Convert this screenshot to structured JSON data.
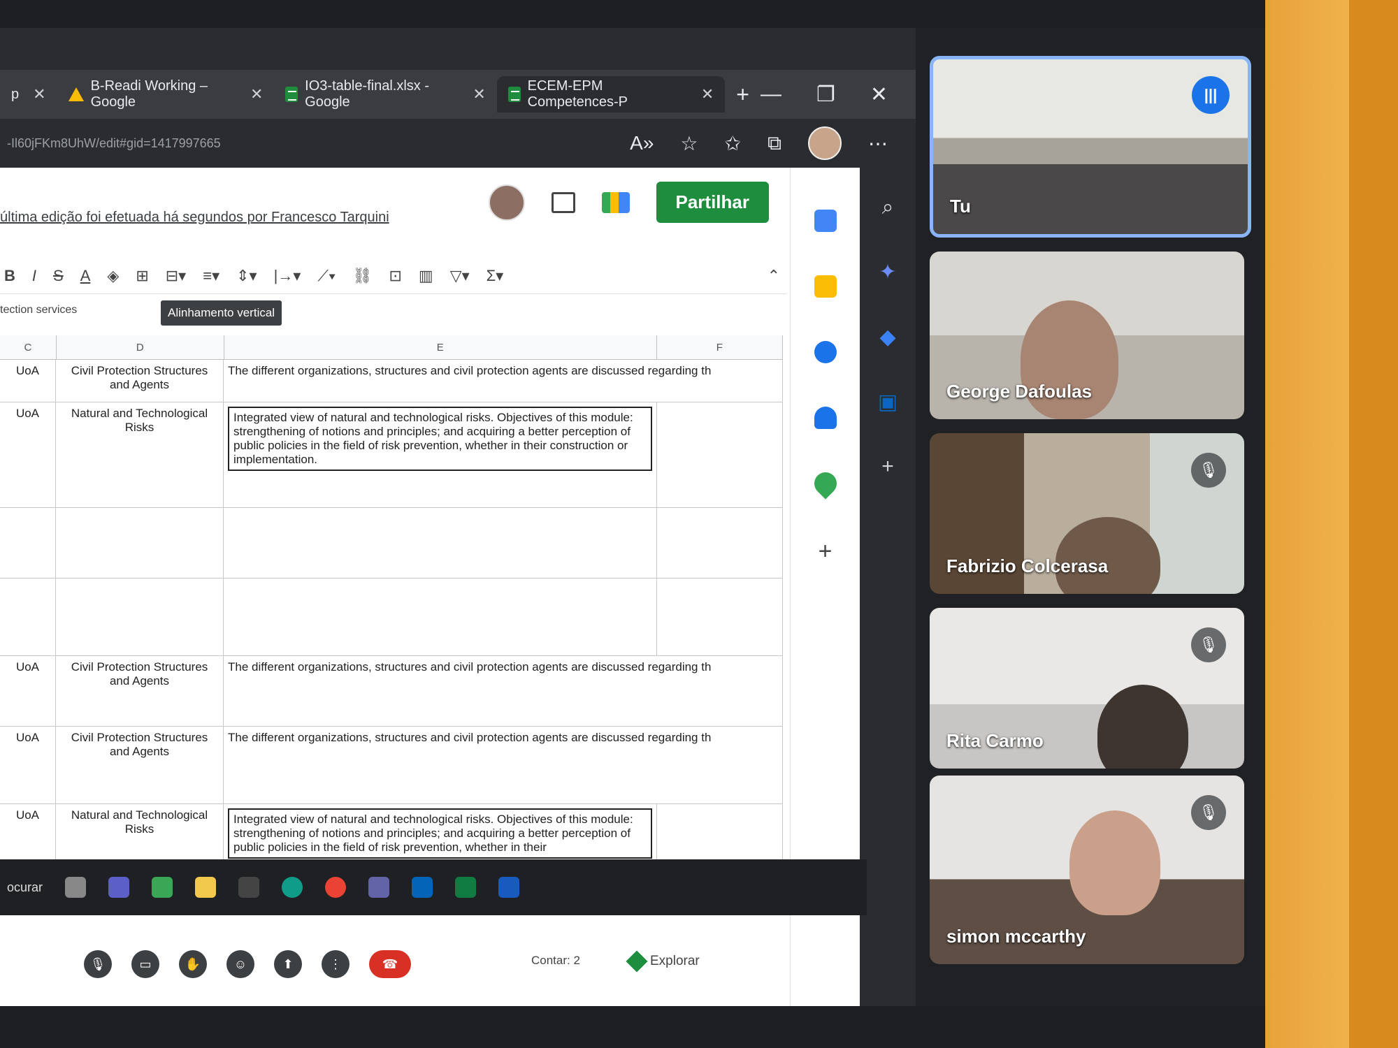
{
  "tabs": [
    {
      "label": "p"
    },
    {
      "label": "B-Readi Working – Google"
    },
    {
      "label": "IO3-table-final.xlsx - Google"
    },
    {
      "label": "ECEM-EPM Competences-P"
    }
  ],
  "url": "-Il60jFKm8UhW/edit#gid=1417997665",
  "sheet": {
    "edit_note": "última edição foi efetuada há segundos por Francesco Tarquini",
    "share_label": "Partilhar",
    "tooltip": "Alinhamento vertical",
    "namebox": "tection services",
    "columns": [
      "C",
      "D",
      "E",
      "F"
    ],
    "rows": [
      {
        "c": "UoA",
        "d": "Civil Protection Structures and Agents",
        "e": "The different organizations, structures and civil protection agents are discussed regarding th"
      },
      {
        "c": "UoA",
        "d": "Natural and Technological Risks",
        "e": "Integrated view of natural and technological risks. Objectives of this module: strengthening of notions and principles; and acquiring a better perception of public policies in the field of risk prevention, whether in their construction or implementation."
      },
      {
        "c": "",
        "d": "",
        "e": ""
      },
      {
        "c": "",
        "d": "",
        "e": ""
      },
      {
        "c": "UoA",
        "d": "Civil Protection Structures and Agents",
        "e": "The different organizations, structures and civil protection agents are discussed regarding th"
      },
      {
        "c": "UoA",
        "d": "Civil Protection Structures and Agents",
        "e": "The different organizations, structures and civil protection agents are discussed regarding th"
      },
      {
        "c": "UoA",
        "d": "Natural and Technological Risks",
        "e": "Integrated view of natural and technological risks. Objectives of this module: strengthening of notions and principles; and acquiring a better perception of public policies in the field of risk prevention, whether in their"
      }
    ],
    "status": "Contar: 2",
    "explore_label": "Explorar"
  },
  "taskbar": {
    "search_label": "ocurar"
  },
  "participants": [
    {
      "name": "Tu"
    },
    {
      "name": "George Dafoulas"
    },
    {
      "name": "Fabrizio Colcerasa"
    },
    {
      "name": "Rita Carmo"
    },
    {
      "name": "simon mccarthy"
    }
  ]
}
